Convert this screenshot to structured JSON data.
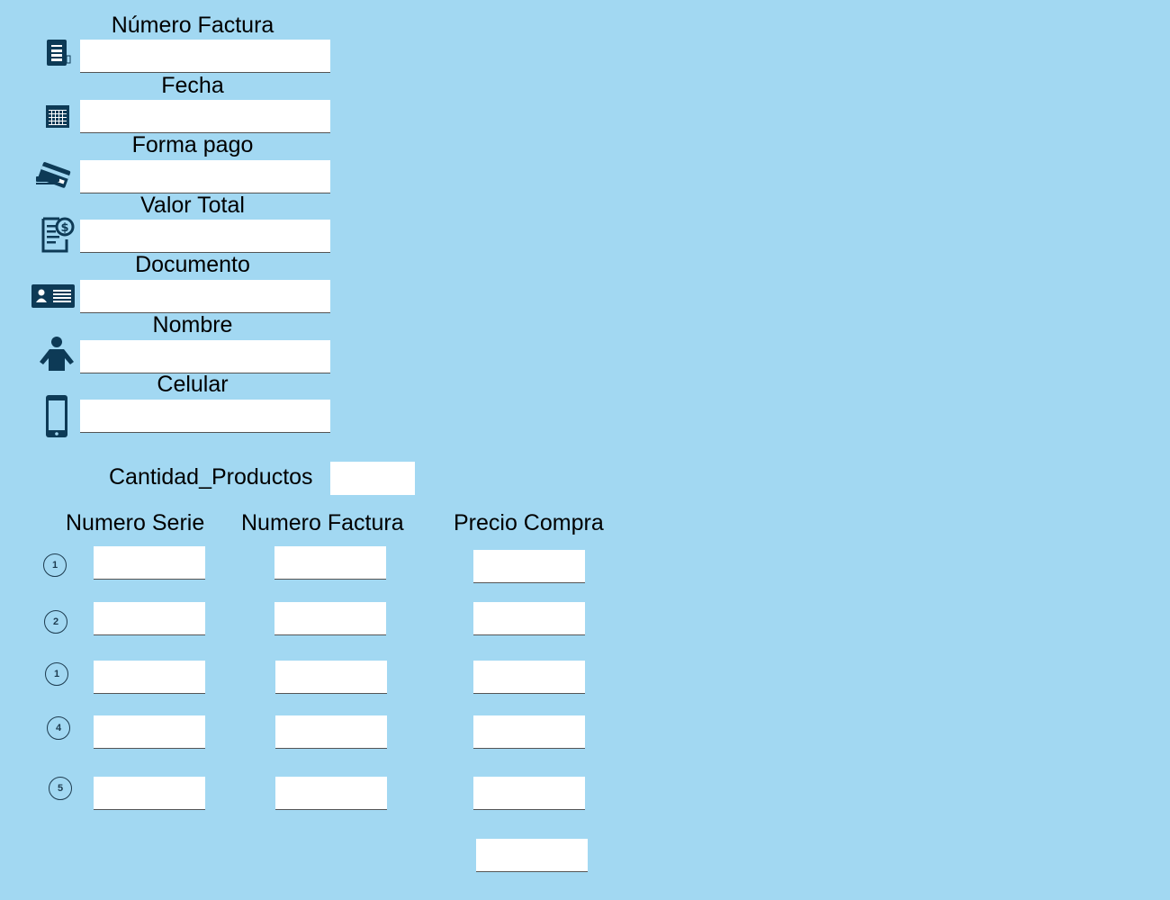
{
  "form": {
    "fields": [
      {
        "label": "Número Factura",
        "icon": "invoice-icon",
        "value": ""
      },
      {
        "label": "Fecha",
        "icon": "calendar-icon",
        "value": ""
      },
      {
        "label": "Forma pago",
        "icon": "credit-cards-icon",
        "value": ""
      },
      {
        "label": "Valor Total",
        "icon": "bill-dollar-icon",
        "value": ""
      },
      {
        "label": "Documento",
        "icon": "id-card-icon",
        "value": ""
      },
      {
        "label": "Nombre",
        "icon": "person-icon",
        "value": ""
      },
      {
        "label": "Celular",
        "icon": "mobile-phone-icon",
        "value": ""
      }
    ]
  },
  "cantidad": {
    "label": "Cantidad_Productos",
    "value": ""
  },
  "products": {
    "headers": [
      "Numero Serie",
      "Numero Factura",
      "Precio Compra"
    ],
    "rows": [
      {
        "badge": "1",
        "serie": "",
        "factura": "",
        "precio": ""
      },
      {
        "badge": "2",
        "serie": "",
        "factura": "",
        "precio": ""
      },
      {
        "badge": "1",
        "serie": "",
        "factura": "",
        "precio": ""
      },
      {
        "badge": "4",
        "serie": "",
        "factura": "",
        "precio": ""
      },
      {
        "badge": "5",
        "serie": "",
        "factura": "",
        "precio": ""
      }
    ],
    "total_value": ""
  },
  "colors": {
    "background": "#a2d8f2",
    "icon": "#0d3a56"
  }
}
